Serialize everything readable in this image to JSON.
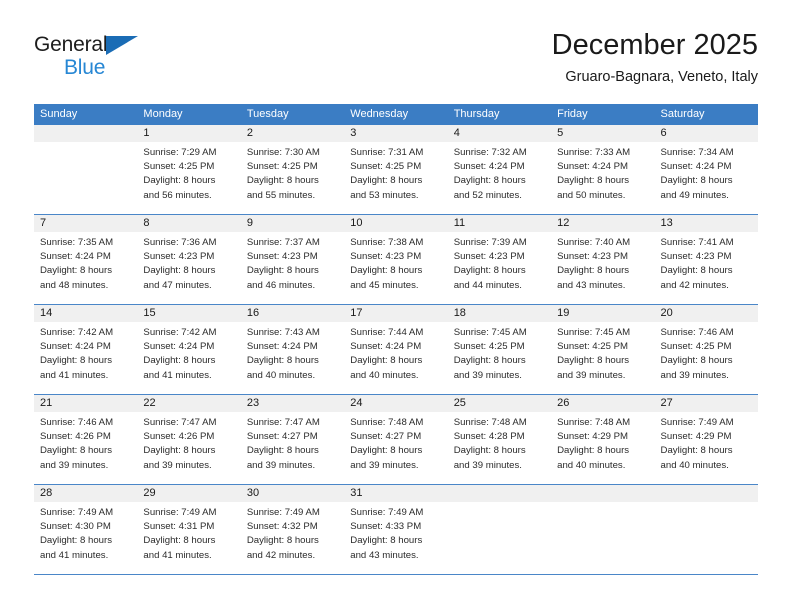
{
  "brand": {
    "line1": "General",
    "line2": "Blue",
    "colors": {
      "dark": "#1d1d1d",
      "blue": "#2787d4",
      "triangle": "#1a6cb5"
    }
  },
  "header": {
    "title": "December 2025",
    "subtitle": "Gruaro-Bagnara, Veneto, Italy"
  },
  "theme": {
    "header_bg": "#3b7dc4",
    "row_border": "#4a86c8",
    "daynum_bg": "#f0f0f0"
  },
  "weekdays": [
    "Sunday",
    "Monday",
    "Tuesday",
    "Wednesday",
    "Thursday",
    "Friday",
    "Saturday"
  ],
  "weeks": [
    [
      {
        "day": "",
        "sunrise": "",
        "sunset": "",
        "daylight1": "",
        "daylight2": ""
      },
      {
        "day": "1",
        "sunrise": "Sunrise: 7:29 AM",
        "sunset": "Sunset: 4:25 PM",
        "daylight1": "Daylight: 8 hours",
        "daylight2": "and 56 minutes."
      },
      {
        "day": "2",
        "sunrise": "Sunrise: 7:30 AM",
        "sunset": "Sunset: 4:25 PM",
        "daylight1": "Daylight: 8 hours",
        "daylight2": "and 55 minutes."
      },
      {
        "day": "3",
        "sunrise": "Sunrise: 7:31 AM",
        "sunset": "Sunset: 4:25 PM",
        "daylight1": "Daylight: 8 hours",
        "daylight2": "and 53 minutes."
      },
      {
        "day": "4",
        "sunrise": "Sunrise: 7:32 AM",
        "sunset": "Sunset: 4:24 PM",
        "daylight1": "Daylight: 8 hours",
        "daylight2": "and 52 minutes."
      },
      {
        "day": "5",
        "sunrise": "Sunrise: 7:33 AM",
        "sunset": "Sunset: 4:24 PM",
        "daylight1": "Daylight: 8 hours",
        "daylight2": "and 50 minutes."
      },
      {
        "day": "6",
        "sunrise": "Sunrise: 7:34 AM",
        "sunset": "Sunset: 4:24 PM",
        "daylight1": "Daylight: 8 hours",
        "daylight2": "and 49 minutes."
      }
    ],
    [
      {
        "day": "7",
        "sunrise": "Sunrise: 7:35 AM",
        "sunset": "Sunset: 4:24 PM",
        "daylight1": "Daylight: 8 hours",
        "daylight2": "and 48 minutes."
      },
      {
        "day": "8",
        "sunrise": "Sunrise: 7:36 AM",
        "sunset": "Sunset: 4:23 PM",
        "daylight1": "Daylight: 8 hours",
        "daylight2": "and 47 minutes."
      },
      {
        "day": "9",
        "sunrise": "Sunrise: 7:37 AM",
        "sunset": "Sunset: 4:23 PM",
        "daylight1": "Daylight: 8 hours",
        "daylight2": "and 46 minutes."
      },
      {
        "day": "10",
        "sunrise": "Sunrise: 7:38 AM",
        "sunset": "Sunset: 4:23 PM",
        "daylight1": "Daylight: 8 hours",
        "daylight2": "and 45 minutes."
      },
      {
        "day": "11",
        "sunrise": "Sunrise: 7:39 AM",
        "sunset": "Sunset: 4:23 PM",
        "daylight1": "Daylight: 8 hours",
        "daylight2": "and 44 minutes."
      },
      {
        "day": "12",
        "sunrise": "Sunrise: 7:40 AM",
        "sunset": "Sunset: 4:23 PM",
        "daylight1": "Daylight: 8 hours",
        "daylight2": "and 43 minutes."
      },
      {
        "day": "13",
        "sunrise": "Sunrise: 7:41 AM",
        "sunset": "Sunset: 4:23 PM",
        "daylight1": "Daylight: 8 hours",
        "daylight2": "and 42 minutes."
      }
    ],
    [
      {
        "day": "14",
        "sunrise": "Sunrise: 7:42 AM",
        "sunset": "Sunset: 4:24 PM",
        "daylight1": "Daylight: 8 hours",
        "daylight2": "and 41 minutes."
      },
      {
        "day": "15",
        "sunrise": "Sunrise: 7:42 AM",
        "sunset": "Sunset: 4:24 PM",
        "daylight1": "Daylight: 8 hours",
        "daylight2": "and 41 minutes."
      },
      {
        "day": "16",
        "sunrise": "Sunrise: 7:43 AM",
        "sunset": "Sunset: 4:24 PM",
        "daylight1": "Daylight: 8 hours",
        "daylight2": "and 40 minutes."
      },
      {
        "day": "17",
        "sunrise": "Sunrise: 7:44 AM",
        "sunset": "Sunset: 4:24 PM",
        "daylight1": "Daylight: 8 hours",
        "daylight2": "and 40 minutes."
      },
      {
        "day": "18",
        "sunrise": "Sunrise: 7:45 AM",
        "sunset": "Sunset: 4:25 PM",
        "daylight1": "Daylight: 8 hours",
        "daylight2": "and 39 minutes."
      },
      {
        "day": "19",
        "sunrise": "Sunrise: 7:45 AM",
        "sunset": "Sunset: 4:25 PM",
        "daylight1": "Daylight: 8 hours",
        "daylight2": "and 39 minutes."
      },
      {
        "day": "20",
        "sunrise": "Sunrise: 7:46 AM",
        "sunset": "Sunset: 4:25 PM",
        "daylight1": "Daylight: 8 hours",
        "daylight2": "and 39 minutes."
      }
    ],
    [
      {
        "day": "21",
        "sunrise": "Sunrise: 7:46 AM",
        "sunset": "Sunset: 4:26 PM",
        "daylight1": "Daylight: 8 hours",
        "daylight2": "and 39 minutes."
      },
      {
        "day": "22",
        "sunrise": "Sunrise: 7:47 AM",
        "sunset": "Sunset: 4:26 PM",
        "daylight1": "Daylight: 8 hours",
        "daylight2": "and 39 minutes."
      },
      {
        "day": "23",
        "sunrise": "Sunrise: 7:47 AM",
        "sunset": "Sunset: 4:27 PM",
        "daylight1": "Daylight: 8 hours",
        "daylight2": "and 39 minutes."
      },
      {
        "day": "24",
        "sunrise": "Sunrise: 7:48 AM",
        "sunset": "Sunset: 4:27 PM",
        "daylight1": "Daylight: 8 hours",
        "daylight2": "and 39 minutes."
      },
      {
        "day": "25",
        "sunrise": "Sunrise: 7:48 AM",
        "sunset": "Sunset: 4:28 PM",
        "daylight1": "Daylight: 8 hours",
        "daylight2": "and 39 minutes."
      },
      {
        "day": "26",
        "sunrise": "Sunrise: 7:48 AM",
        "sunset": "Sunset: 4:29 PM",
        "daylight1": "Daylight: 8 hours",
        "daylight2": "and 40 minutes."
      },
      {
        "day": "27",
        "sunrise": "Sunrise: 7:49 AM",
        "sunset": "Sunset: 4:29 PM",
        "daylight1": "Daylight: 8 hours",
        "daylight2": "and 40 minutes."
      }
    ],
    [
      {
        "day": "28",
        "sunrise": "Sunrise: 7:49 AM",
        "sunset": "Sunset: 4:30 PM",
        "daylight1": "Daylight: 8 hours",
        "daylight2": "and 41 minutes."
      },
      {
        "day": "29",
        "sunrise": "Sunrise: 7:49 AM",
        "sunset": "Sunset: 4:31 PM",
        "daylight1": "Daylight: 8 hours",
        "daylight2": "and 41 minutes."
      },
      {
        "day": "30",
        "sunrise": "Sunrise: 7:49 AM",
        "sunset": "Sunset: 4:32 PM",
        "daylight1": "Daylight: 8 hours",
        "daylight2": "and 42 minutes."
      },
      {
        "day": "31",
        "sunrise": "Sunrise: 7:49 AM",
        "sunset": "Sunset: 4:33 PM",
        "daylight1": "Daylight: 8 hours",
        "daylight2": "and 43 minutes."
      },
      {
        "day": "",
        "sunrise": "",
        "sunset": "",
        "daylight1": "",
        "daylight2": ""
      },
      {
        "day": "",
        "sunrise": "",
        "sunset": "",
        "daylight1": "",
        "daylight2": ""
      },
      {
        "day": "",
        "sunrise": "",
        "sunset": "",
        "daylight1": "",
        "daylight2": ""
      }
    ]
  ]
}
